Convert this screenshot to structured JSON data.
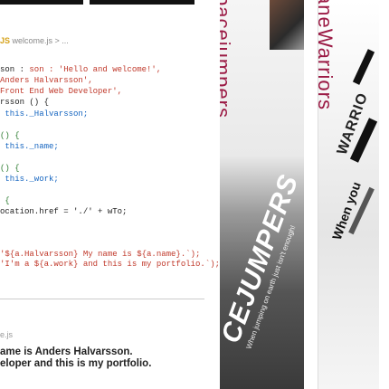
{
  "code": {
    "file_crumb_lang": "JS",
    "file_crumb_path": "welcome.js > ...",
    "lines": [
      {
        "top": 0,
        "text": ""
      },
      {
        "text": "son : 'Hello and welcome!',"
      },
      {
        "text": "Anders Halvarsson',"
      },
      {
        "text": "Front End Web Developer',"
      },
      {
        "text": "rsson () {"
      },
      {
        "text": " this._Halvarsson;"
      },
      {
        "text": ""
      },
      {
        "text": "() {"
      },
      {
        "text": " this._name;"
      },
      {
        "text": ""
      },
      {
        "text": "() {"
      },
      {
        "text": " this._work;"
      },
      {
        "text": ""
      },
      {
        "text": " {"
      },
      {
        "text": "ocation.href = './' + wTo;"
      }
    ],
    "template_line_1": "'${a.Halvarsson} My name is ${a.name}.`);",
    "template_line_2": "'I'm a ${a.work} and this is my portfolio.`);",
    "output_crumb": "e.js",
    "output_line_1": "ame is Anders Halvarsson.",
    "output_line_2": "eloper and this is my portfolio."
  },
  "card1": {
    "vertical_title": "pacejumpers",
    "big_title": "CEJUMPERS",
    "tagline_1": "When jumping on earth just isn't enough!"
  },
  "card2": {
    "vertical_title": "aneWarriors",
    "diag_title": "WARRIO",
    "diag_sub": "When you"
  }
}
